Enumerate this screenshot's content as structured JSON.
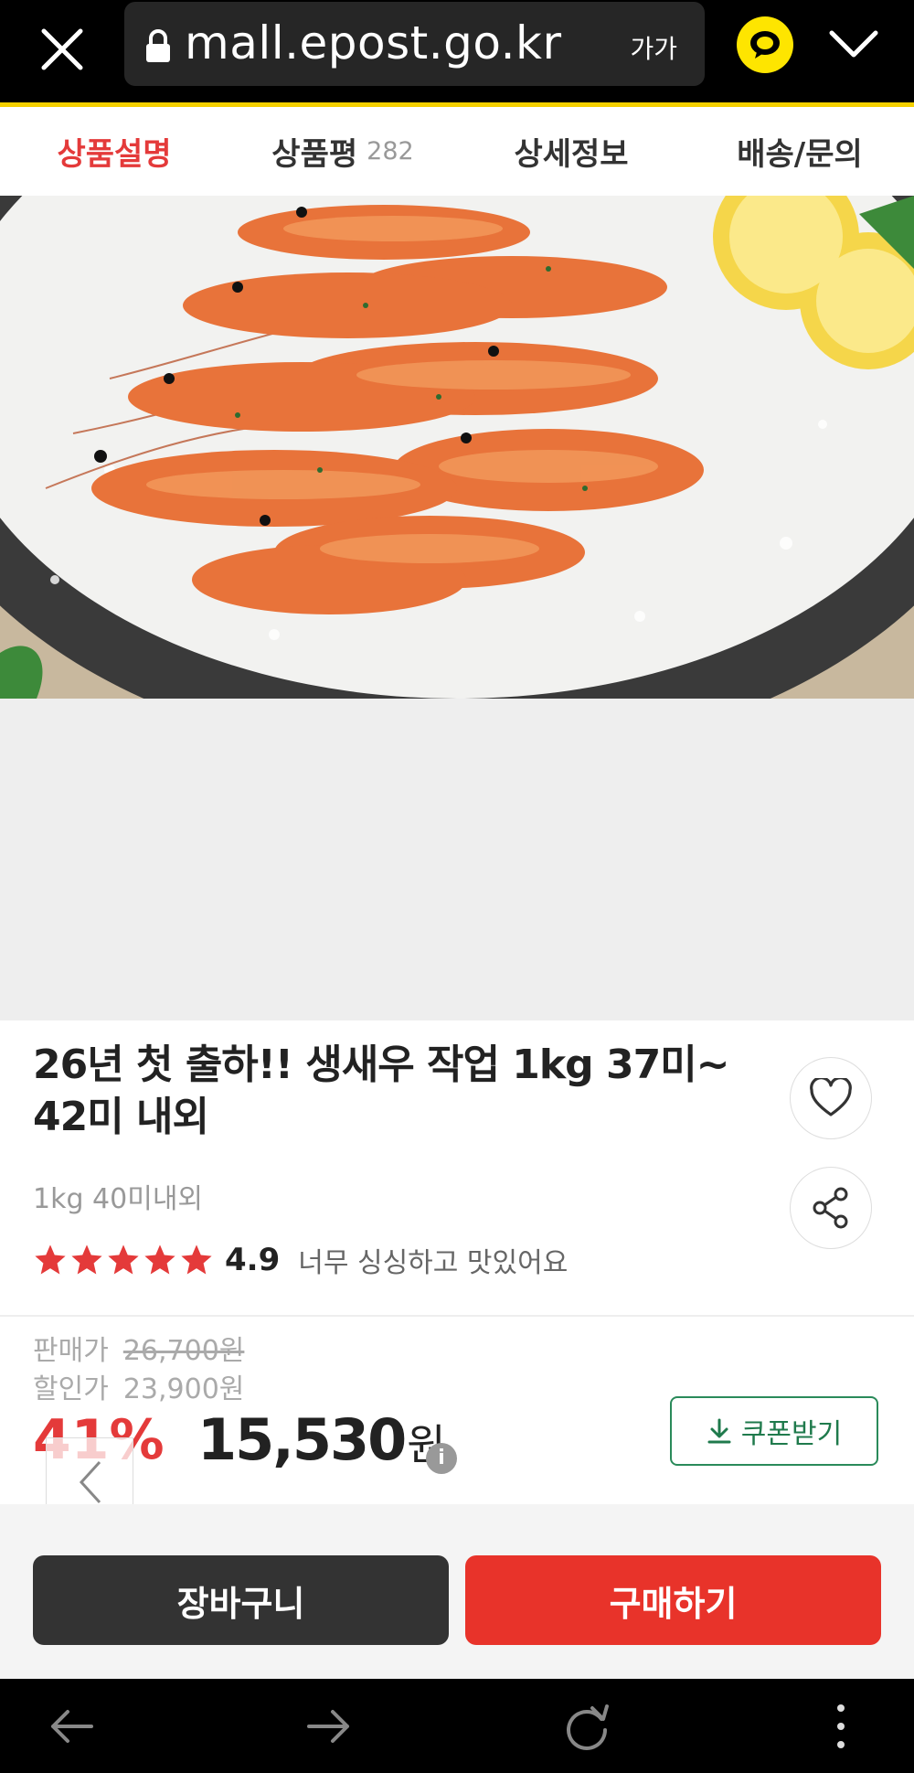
{
  "browser": {
    "url": "mall.epost.go.kr",
    "text_size_label": "가가",
    "icons": [
      "close-icon",
      "lock-icon",
      "kakao-talk-icon",
      "chevron-down-icon"
    ]
  },
  "tabs": [
    {
      "label": "상품설명",
      "count": ""
    },
    {
      "label": "상품평",
      "count": "282"
    },
    {
      "label": "상세정보",
      "count": ""
    },
    {
      "label": "배송/문의",
      "count": ""
    }
  ],
  "product": {
    "title": "26년 첫 출하!! 생새우 작업 1kg 37미~ 42미 내외",
    "subtitle": "1kg 40미내외",
    "rating": "4.9",
    "stars": 5,
    "review_snippet": "너무 싱싱하고 맛있어요"
  },
  "price": {
    "sale_label": "판매가",
    "sale_value": "26,700원",
    "discount_label": "할인가",
    "discount_value": "23,900원",
    "discount_rate": "41%",
    "final_amount": "15,530",
    "final_unit": "원",
    "info_icon": "i",
    "coupon_label": "쿠폰받기"
  },
  "actions": {
    "cart_label": "장바구니",
    "buy_label": "구매하기"
  },
  "colors": {
    "accent_red": "#e43a3a",
    "buy_red": "#e8332a",
    "coupon_green": "#2a8a5a",
    "kakao_yellow": "#fee500"
  }
}
